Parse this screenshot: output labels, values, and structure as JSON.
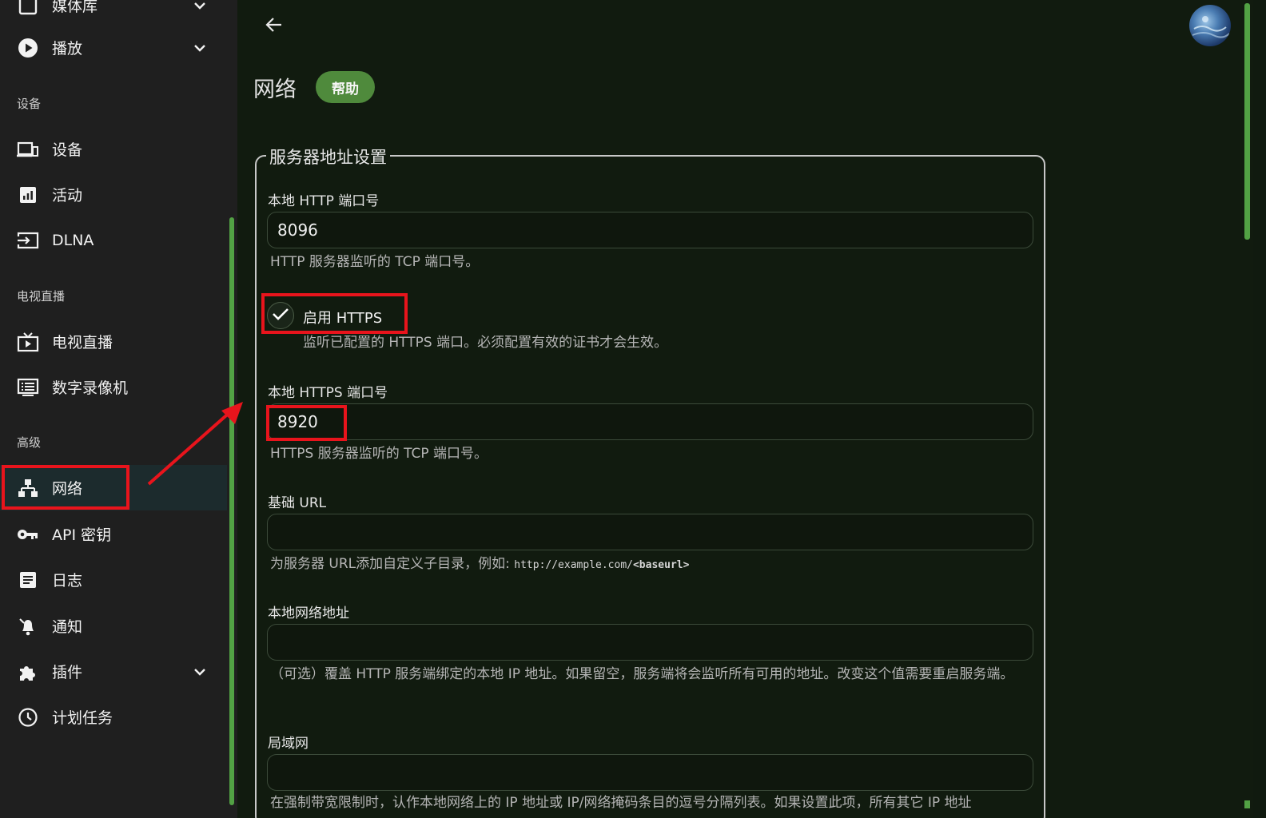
{
  "sidebar": {
    "top_partial_label": "媒体库",
    "items": [
      {
        "label": "播放",
        "icon": "play-circle-icon",
        "has_chevron": true
      },
      {
        "label": "设备",
        "icon": "devices-icon"
      },
      {
        "label": "活动",
        "icon": "activity-chart-icon"
      },
      {
        "label": "DLNA",
        "icon": "input-icon"
      },
      {
        "label": "电视直播",
        "icon": "live-tv-icon"
      },
      {
        "label": "数字录像机",
        "icon": "dvr-icon"
      },
      {
        "label": "网络",
        "icon": "network-icon",
        "active": true
      },
      {
        "label": "API 密钥",
        "icon": "key-icon"
      },
      {
        "label": "日志",
        "icon": "log-icon"
      },
      {
        "label": "通知",
        "icon": "notification-icon"
      },
      {
        "label": "插件",
        "icon": "plugin-icon",
        "has_chevron": true
      },
      {
        "label": "计划任务",
        "icon": "clock-icon"
      }
    ],
    "sections": {
      "devices": "设备",
      "livetv": "电视直播",
      "advanced": "高级"
    }
  },
  "header": {
    "title": "网络",
    "help_label": "帮助"
  },
  "form": {
    "legend": "服务器地址设置",
    "http_port": {
      "label": "本地 HTTP 端口号",
      "value": "8096",
      "hint": "HTTP 服务器监听的 TCP 端口号。"
    },
    "enable_https": {
      "label": "启用 HTTPS",
      "checked": true,
      "hint": "监听已配置的 HTTPS 端口。必须配置有效的证书才会生效。"
    },
    "https_port": {
      "label": "本地 HTTPS 端口号",
      "value": "8920",
      "hint": "HTTPS 服务器监听的 TCP 端口号。"
    },
    "base_url": {
      "label": "基础 URL",
      "value": "",
      "hint_prefix": "为服务器 URL添加自定义子目录，例如:",
      "hint_code": "http://example.com/",
      "hint_code_bold": "<baseurl>"
    },
    "local_address": {
      "label": "本地网络地址",
      "value": "",
      "hint": "（可选）覆盖 HTTP 服务端绑定的本地 IP 地址。如果留空，服务端将会监听所有可用的地址。改变这个值需要重启服务端。"
    },
    "lan": {
      "label": "局域网",
      "value": "",
      "hint": "在强制带宽限制时，认作本地网络上的 IP 地址或 IP/网络掩码条目的逗号分隔列表。如果设置此项，所有其它 IP 地址"
    }
  },
  "colors": {
    "accent": "#52a144",
    "highlight": "#e8141c",
    "help_button": "#4f8a3c"
  }
}
